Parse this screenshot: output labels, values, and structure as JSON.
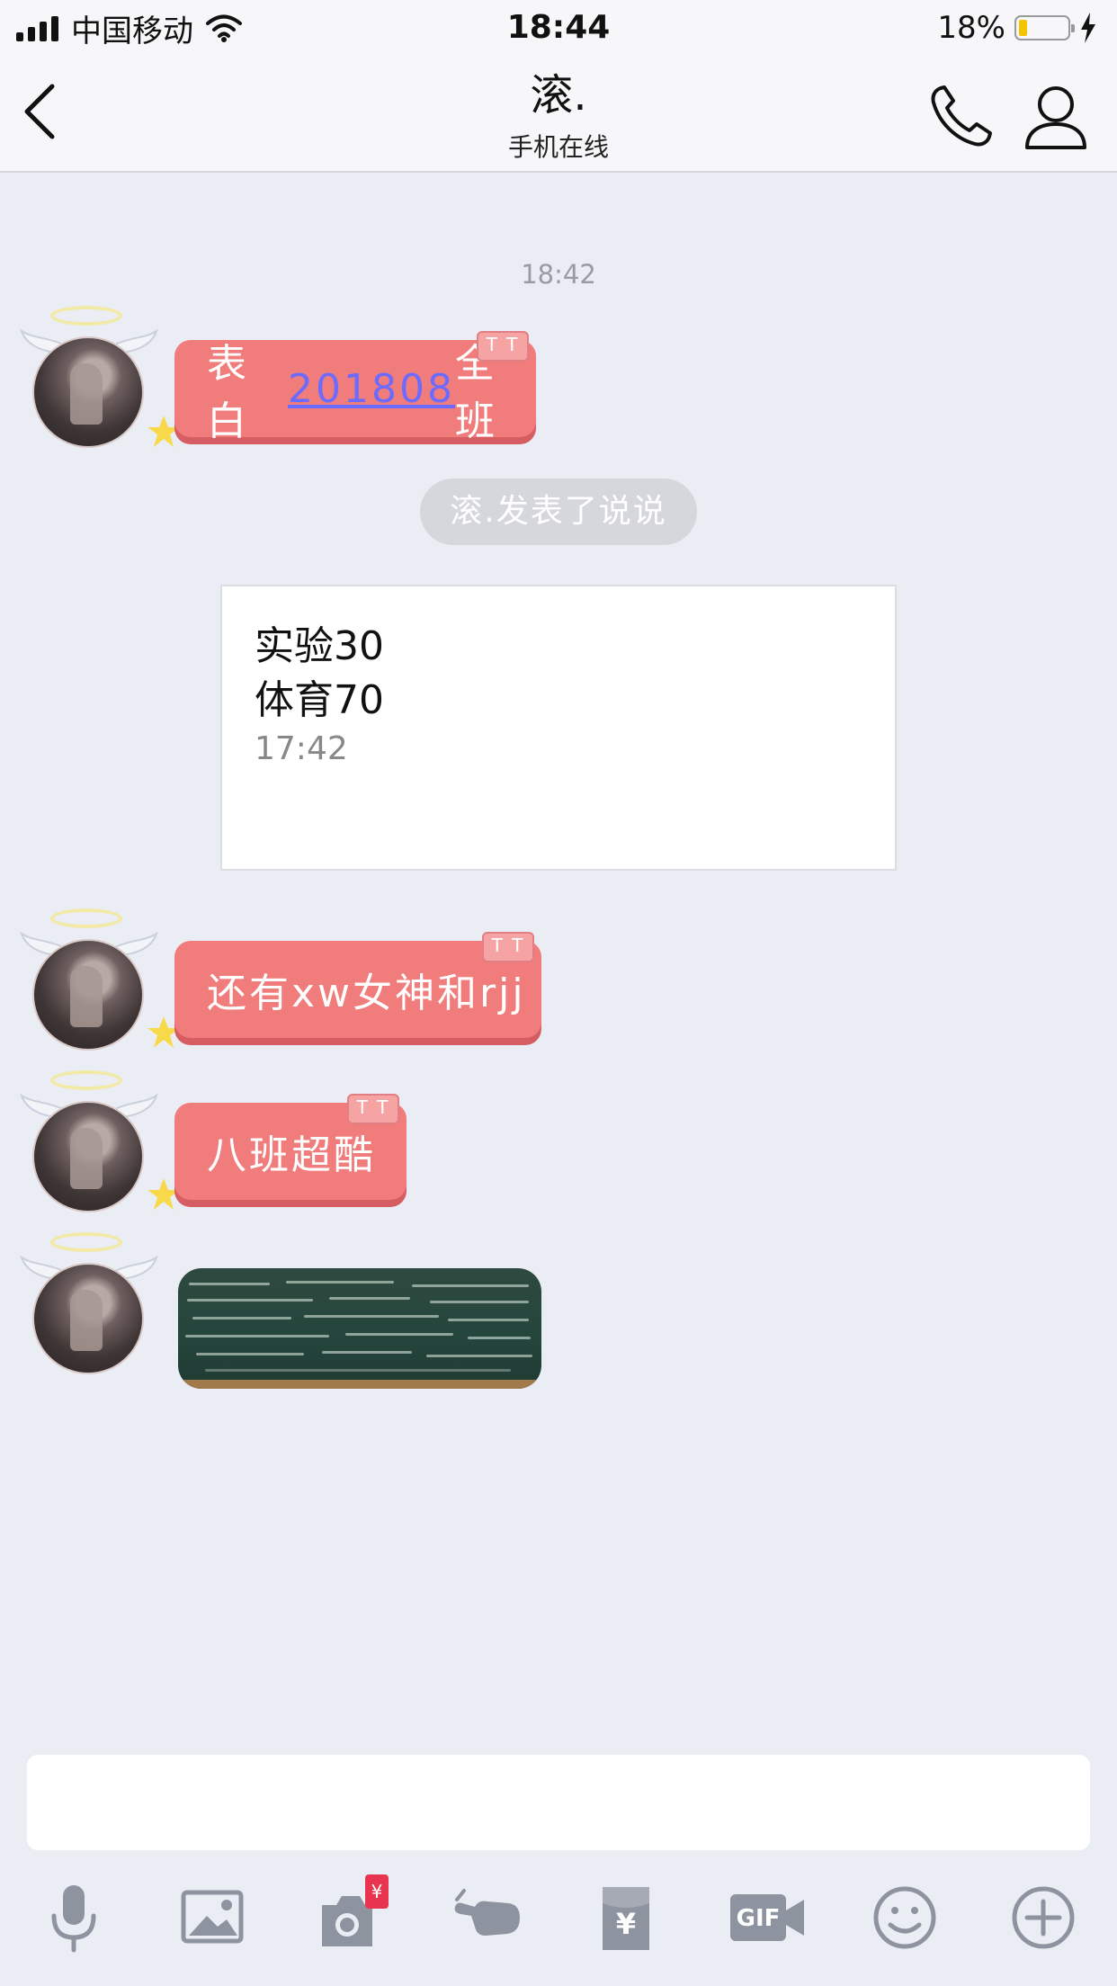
{
  "status_bar": {
    "carrier": "中国移动",
    "time": "18:44",
    "battery_percent": "18%",
    "battery_level": 0.18
  },
  "nav": {
    "title": "滚.",
    "subtitle": "手机在线"
  },
  "chat": {
    "timestamp": "18:42",
    "messages": [
      {
        "prefix": "表白",
        "link": "201808",
        "suffix": "全班",
        "badge": "T T"
      },
      {
        "text": "还有xw女神和rjj",
        "badge": "T T"
      },
      {
        "text": "八班超酷",
        "badge": "T T"
      }
    ],
    "system_notice": "滚.发表了说说",
    "post_card": {
      "line1": "实验30",
      "line2": "体育70",
      "time": "17:42"
    }
  },
  "input": {
    "value": ""
  },
  "toolbar": {
    "icons": [
      "microphone-icon",
      "image-icon",
      "camera-icon",
      "poke-icon",
      "red-packet-icon",
      "gif-icon",
      "emoji-icon",
      "plus-icon"
    ],
    "camera_badge": "¥",
    "red_packet_label": "¥",
    "gif_label": "GIF"
  },
  "colors": {
    "bubble": "#f07c7c",
    "background": "#ebedf5",
    "link": "#6b6bff"
  }
}
